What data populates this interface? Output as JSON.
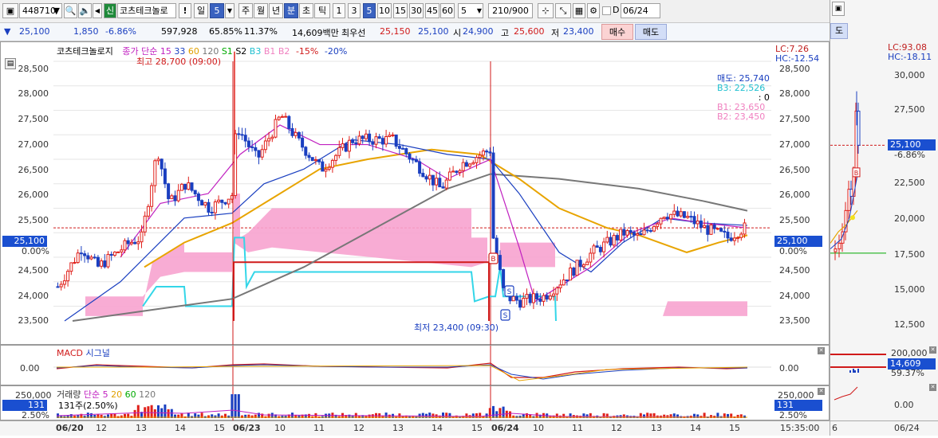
{
  "toolbar": {
    "code": "448710",
    "new_badge": "신",
    "name": "코츠테크놀로",
    "warn": "!",
    "period_il": "일",
    "period_value": "5",
    "ju": "주",
    "wol": "월",
    "nyeon": "년",
    "bun": "분",
    "cho": "초",
    "tik": "틱",
    "intervals": [
      "1",
      "3",
      "5",
      "10",
      "15",
      "30",
      "45",
      "60"
    ],
    "interval_input": "5",
    "count": "210/900",
    "checkbox_d": "D",
    "date": "06/24"
  },
  "info": {
    "price": "25,100",
    "change": "1,850",
    "change_pct": "-6.86%",
    "volume": "597,928",
    "ratio1": "65.85%",
    "ratio2": "11.37%",
    "amount": "14,609백만",
    "best_label": "최우선",
    "best1": "25,150",
    "best2": "25,100",
    "open_label": "시",
    "open": "24,900",
    "high_label": "고",
    "high": "25,600",
    "low_label": "저",
    "low": "23,400",
    "buy": "매수",
    "sell": "매도"
  },
  "legend": {
    "name": "코츠테크놀로지",
    "ma_label": "종가 단순",
    "ma15": "15",
    "ma33": "33",
    "ma60": "60",
    "ma120": "120",
    "s1": "S1",
    "s2": "S2",
    "b3": "B3",
    "b1": "B1",
    "b2": "B2",
    "pct15": "-15%",
    "pct20": "-20%"
  },
  "annotations": {
    "high": "최고 28,700 (09:00)",
    "low": "최저 23,400 (09:30)"
  },
  "main_right": {
    "lc": "LC:7.26",
    "hc": "HC:-12.54",
    "sell_label": "매도: 25,740",
    "b3_label": "B3: 22,526",
    "colon0": ": 0",
    "b1_label": "B1: 23,650",
    "b2_label": "B2: 23,450",
    "s1_label": "S1",
    "s2_label": "S2",
    "price_tag": "25,100",
    "pct_tag": "0.00%"
  },
  "y_ticks": [
    "28,500",
    "28,000",
    "27,500",
    "27,000",
    "26,500",
    "26,000",
    "25,500",
    "25,000",
    "24,500",
    "24,000",
    "23,500"
  ],
  "left_tag": {
    "price": "25,100",
    "pct": "0.00%"
  },
  "macd": {
    "label1": "MACD",
    "label2": "시그널",
    "zero": "0.00"
  },
  "volume_panel": {
    "label": "거래량",
    "ma_label": "단순",
    "ma5": "5",
    "ma20": "20",
    "ma60": "60",
    "ma120": "120",
    "detail": "131주(2.50%)",
    "ytick": "250,000",
    "tag_val": "131",
    "tag_pct": "2.50%"
  },
  "x_axis": {
    "labels": [
      "06/20",
      "12",
      "13",
      "14",
      "15",
      "06/23",
      "10",
      "11",
      "12",
      "13",
      "14",
      "15",
      "06/24",
      "10",
      "11",
      "12",
      "13",
      "14",
      "15"
    ],
    "end_time": "15:35:00"
  },
  "right_pane": {
    "tab": "도",
    "lc": "LC:93.08",
    "hc": "HC:-18.11",
    "ticks": [
      "30,000",
      "27,500",
      "25,000",
      "22,500",
      "20,000",
      "17,500",
      "15,000",
      "12,500"
    ],
    "price_tag": "25,100",
    "pct": "-6.86%",
    "vol_tick": "200,000",
    "vol_tag": "14,609",
    "vol_pct": "59.37%",
    "macd_zero": "0.00",
    "x_left": "6",
    "x_date": "06/24"
  },
  "chart_data": {
    "type": "candlestick",
    "title": "코츠테크놀로지",
    "interval": "5분",
    "ylim": [
      23200,
      28900
    ],
    "high": {
      "value": 28700,
      "time": "06/23 09:00"
    },
    "low": {
      "value": 23400,
      "time": "06/24 09:30"
    },
    "current": 25100
  }
}
